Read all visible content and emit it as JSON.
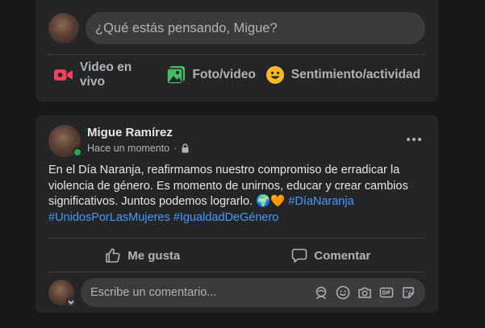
{
  "composer": {
    "placeholder": "¿Qué estás pensando, Migue?",
    "actions": [
      {
        "label": "Video en vivo",
        "icon": "live-video-icon",
        "color": "#f3425f"
      },
      {
        "label": "Foto/video",
        "icon": "photo-video-icon",
        "color": "#45bd62"
      },
      {
        "label": "Sentimiento/actividad",
        "icon": "feeling-activity-icon",
        "color": "#f7b928"
      }
    ]
  },
  "post": {
    "author": "Migue Ramírez",
    "timestamp": "Hace un momento",
    "separator": "·",
    "text": "En el Día Naranja, reafirmamos nuestro compromiso de erradicar la violencia de género. Es momento de unirnos, educar y crear cambios significativos. Juntos podemos lograrlo. 🌍🧡",
    "hashtags": [
      "#DíaNaranja",
      "#UnidosPorLasMujeres",
      "#IgualdadDeGénero"
    ],
    "like_label": "Me gusta",
    "comment_label": "Comentar",
    "comment_placeholder": "Escribe un comentario..."
  },
  "colors": {
    "background": "#18191a",
    "card": "#242526",
    "input": "#3a3b3c",
    "hashtag": "#4599ff",
    "online": "#31a24c"
  }
}
